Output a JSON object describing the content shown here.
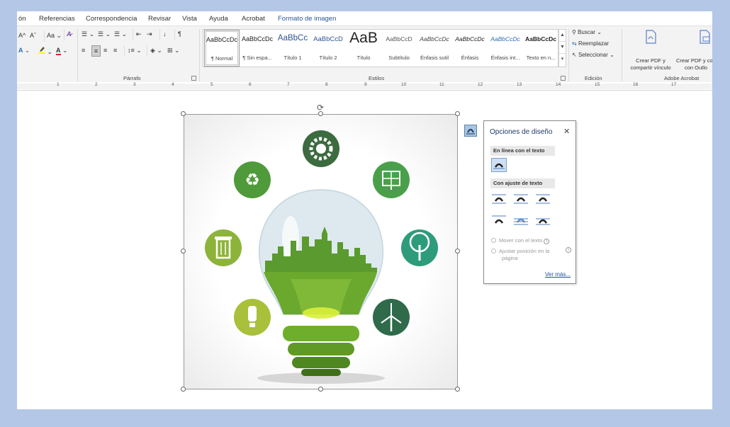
{
  "tabs": [
    {
      "label": "ón"
    },
    {
      "label": "Referencias"
    },
    {
      "label": "Correspondencia"
    },
    {
      "label": "Revisar"
    },
    {
      "label": "Vista"
    },
    {
      "label": "Ayuda"
    },
    {
      "label": "Acrobat"
    },
    {
      "label": "Formato de imagen"
    }
  ],
  "active_tab_color": "#2b579a",
  "ribbon": {
    "font_group": {
      "grow_icon": "A^",
      "shrink_icon": "Aˇ",
      "case_label": "Aa",
      "text_effects_icon": "A",
      "highlight_icon": "marker-icon",
      "font_color_icon": "A",
      "font_color": "#e02020",
      "highlight_color": "#ffff00"
    },
    "paragraph_group": {
      "label": "Párrafo"
    },
    "styles_group": {
      "label": "Estilos",
      "styles": [
        {
          "sample": "AaBbCcDc",
          "name": "¶ Normal"
        },
        {
          "sample": "AaBbCcDc",
          "name": "¶ Sin espa..."
        },
        {
          "sample": "AaBbCc",
          "name": "Título 1"
        },
        {
          "sample": "AaBbCcD",
          "name": "Título 2"
        },
        {
          "sample": "AaB",
          "name": "Título"
        },
        {
          "sample": "AaBbCcD",
          "name": "Subtítulo"
        },
        {
          "sample": "AaBbCcDc",
          "name": "Énfasis sutil"
        },
        {
          "sample": "AaBbCcDc",
          "name": "Énfasis"
        },
        {
          "sample": "AaBbCcDc",
          "name": "Énfasis int..."
        },
        {
          "sample": "AaBbCcDc",
          "name": "Texto en n..."
        }
      ]
    },
    "editing_group": {
      "label": "Edición",
      "find": "Buscar",
      "replace": "Reemplazar",
      "select": "Seleccionar"
    },
    "acrobat_group": {
      "label": "Adobe Acrobat",
      "create_pdf_link_line1": "Crear PDF y",
      "create_pdf_link_line2": "compartir vínculo",
      "create_pdf_outlook_line1": "Crear PDF y co",
      "create_pdf_outlook_line2": "con Outlo"
    }
  },
  "ruler": {
    "numbers": [
      "1",
      "2",
      "3",
      "4",
      "5",
      "6",
      "7",
      "8",
      "9",
      "10",
      "11",
      "12",
      "13",
      "14",
      "15",
      "16",
      "17"
    ]
  },
  "image": {
    "description_icons": [
      "gear-icon",
      "recycle-icon",
      "solar-panel-icon",
      "trash-can-icon",
      "tree-icon",
      "cfl-bulb-icon",
      "wind-turbine-icon"
    ],
    "dark_green": "#3c6b3f",
    "mid_green": "#5a9a3a",
    "light_green": "#8db43a",
    "teal": "#2e9c7a"
  },
  "layout_popup": {
    "title": "Opciones de diseño",
    "inline_section": "En línea con el texto",
    "wrap_section": "Con ajuste de texto",
    "move_with_text": "Mover con el texto",
    "fix_position_line1": "Ajustar posición en la",
    "fix_position_line2": "página",
    "see_more": "Ver más..."
  }
}
